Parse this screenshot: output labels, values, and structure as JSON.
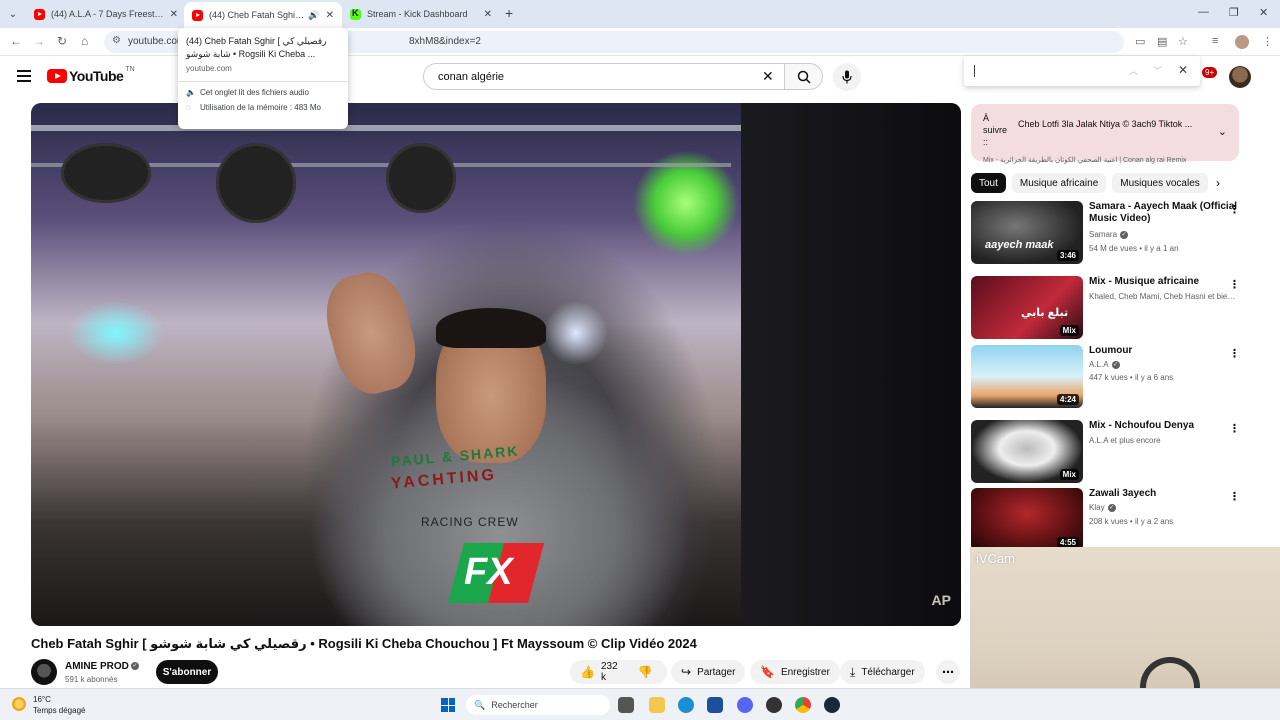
{
  "browser": {
    "tabs": [
      {
        "title": "(44) A.L.A - 7 Days Freestyle - Y",
        "favicon": "youtube-icon",
        "active": false
      },
      {
        "title": "(44) Cheb Fatah Sghir [ رقصيلي كي شابة شوشو",
        "favicon": "youtube-icon",
        "active": true,
        "audio": true
      },
      {
        "title": "Stream - Kick Dashboard",
        "favicon": "kick-icon",
        "active": false
      }
    ],
    "address_left": "youtube.com",
    "address_right": "8xhM8&index=2"
  },
  "hover_card": {
    "title": "(44) Cheb Fatah Sghir [ رقصيلي كي شابة شوشو • Rogsili Ki Cheba ...",
    "domain": "youtube.com",
    "audio_note": "Cet onglet lit des fichiers audio",
    "memory_note": "Utilisation de la mémoire : 483 Mo"
  },
  "youtube": {
    "logo_text": "YouTube",
    "country_code": "TN",
    "search_value": "conan algérie",
    "notifications_badge": "9+"
  },
  "video": {
    "title": "Cheb Fatah Sghir [ رقصيلي كي شابة شوشو • Rogsili Ki Cheba Chouchou ] Ft Mayssoum © Clip Vidéo 2024",
    "shirt_text_1": "PAUL & SHARK",
    "shirt_text_2": "YACHTING",
    "shirt_text_3": "RACING CREW",
    "logo_overlay": "FX",
    "watermark": "AP",
    "channel_name": "AMINE PROD",
    "subscribers": "591 k abonnés",
    "subscribe_label": "S'abonner",
    "likes": "232 k",
    "share_label": "Partager",
    "save_label": "Enregistrer",
    "download_label": "Télécharger"
  },
  "mix_card": {
    "label": "À suivre ::",
    "next_title": "Cheb Lotfi 3la Jalak Ntiya © 3ach9 Tiktok ...",
    "subtitle": "Mix - اغنية الصحفي الكوتان بالطريقة الجزائرية | Conan alg rai Remix"
  },
  "chips": [
    "Tout",
    "Musique africaine",
    "Musiques vocales"
  ],
  "recommendations": [
    {
      "title": "Samara - Aayech Maak (Official Music Video)",
      "channel": "Samara",
      "verified": true,
      "meta": "54 M de vues • il y a 1 an",
      "duration": "3:46",
      "thumb_text": "aayech maak"
    },
    {
      "title": "Mix - Musique africaine",
      "channel": "Khaled, Cheb Mami, Cheb Hasni et bien ...",
      "verified": false,
      "meta": "",
      "duration": "Mix",
      "thumb_text": "تبلع بابي"
    },
    {
      "title": "Loumour",
      "channel": "A.L.A",
      "verified": true,
      "meta": "447 k vues • il y a 6 ans",
      "duration": "4:24",
      "thumb_text": ""
    },
    {
      "title": "Mix - Nchoufou Denya",
      "channel": "A.L.A et plus encore",
      "verified": false,
      "meta": "",
      "duration": "Mix",
      "thumb_text": ""
    },
    {
      "title": "Zawali 3ayech",
      "channel": "Klay",
      "verified": true,
      "meta": "208 k vues • il y a 2 ans",
      "duration": "4:55",
      "thumb_text": ""
    }
  ],
  "ivcam": {
    "label": "iVCam"
  },
  "taskbar": {
    "temperature": "16°C",
    "weather": "Temps dégagé",
    "search_placeholder": "Rechercher"
  }
}
